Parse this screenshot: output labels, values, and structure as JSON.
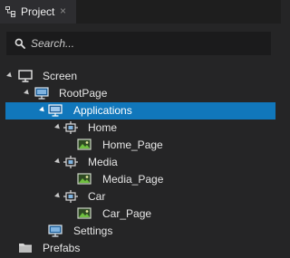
{
  "tab": {
    "title": "Project",
    "close_glyph": "×"
  },
  "search": {
    "placeholder": "Search..."
  },
  "tree": {
    "screen": "Screen",
    "rootpage": "RootPage",
    "applications": "Applications",
    "home": "Home",
    "home_page": "Home_Page",
    "media": "Media",
    "media_page": "Media_Page",
    "car": "Car",
    "car_page": "Car_Page",
    "settings": "Settings",
    "prefabs": "Prefabs"
  },
  "colors": {
    "background": "#252526",
    "selection": "#1177bb",
    "search_bg": "#1b1b1c"
  }
}
